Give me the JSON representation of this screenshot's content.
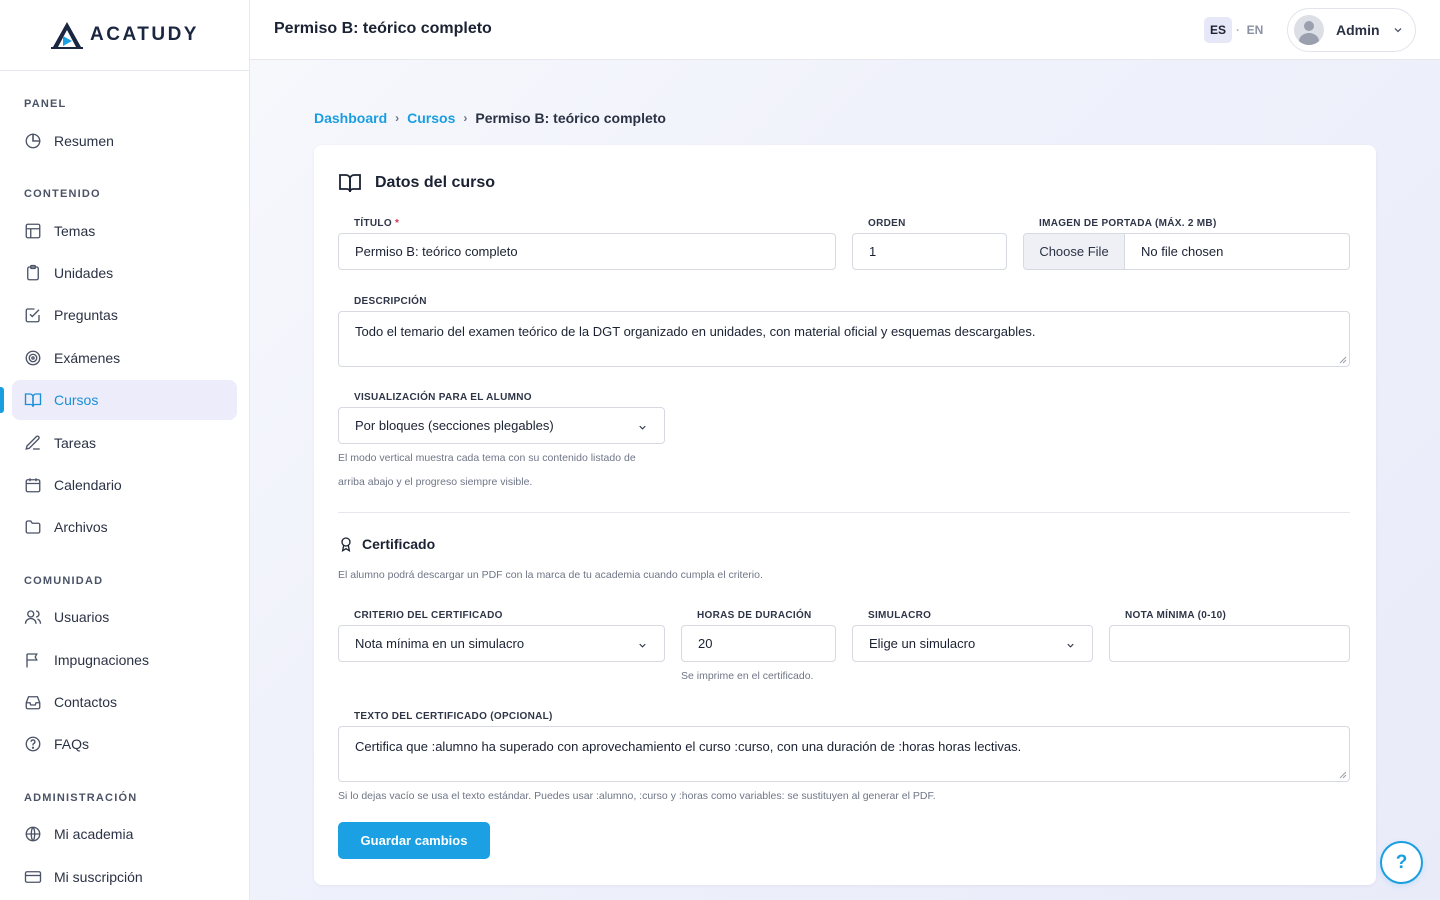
{
  "app": {
    "brand": "ACATUDY"
  },
  "topbar": {
    "title": "Permiso B: teórico completo",
    "lang_es": "ES",
    "lang_sep": "·",
    "lang_en": "EN",
    "user": "Admin"
  },
  "sidebar": {
    "sections": {
      "panel": "PANEL",
      "contenido": "CONTENIDO",
      "comunidad": "COMUNIDAD",
      "administracion": "ADMINISTRACIÓN"
    },
    "items": {
      "resumen": "Resumen",
      "temas": "Temas",
      "unidades": "Unidades",
      "preguntas": "Preguntas",
      "examenes": "Exámenes",
      "cursos": "Cursos",
      "tareas": "Tareas",
      "calendario": "Calendario",
      "archivos": "Archivos",
      "usuarios": "Usuarios",
      "impugnaciones": "Impugnaciones",
      "contactos": "Contactos",
      "faqs": "FAQs",
      "mi_academia": "Mi academia",
      "mi_suscripcion": "Mi suscripción"
    },
    "active": "cursos"
  },
  "breadcrumb": {
    "dashboard": "Dashboard",
    "cursos": "Cursos",
    "current": "Permiso B: teórico completo",
    "separator": "›"
  },
  "form": {
    "card_title": "Datos del curso",
    "titulo": {
      "label": "TÍTULO",
      "required_mark": "*",
      "value": "Permiso B: teórico completo"
    },
    "orden": {
      "label": "ORDEN",
      "value": "1"
    },
    "imagen": {
      "label": "IMAGEN DE PORTADA (MÁX. 2 MB)",
      "button": "Choose File",
      "status": "No file chosen"
    },
    "descripcion": {
      "label": "DESCRIPCIÓN",
      "value": "Todo el temario del examen teórico de la DGT organizado en unidades, con material oficial y esquemas descargables."
    },
    "visualizacion": {
      "label": "VISUALIZACIÓN PARA EL ALUMNO",
      "value": "Por bloques (secciones plegables)",
      "help_line1": "El modo vertical muestra cada tema con su contenido listado de",
      "help_line2": "arriba abajo y el progreso siempre visible."
    },
    "certificado": {
      "title": "Certificado",
      "description": "El alumno podrá descargar un PDF con la marca de tu academia cuando cumpla el criterio.",
      "criterio": {
        "label": "CRITERIO DEL CERTIFICADO",
        "value": "Nota mínima en un simulacro"
      },
      "horas": {
        "label": "HORAS DE DURACIÓN",
        "value": "20",
        "help": "Se imprime en el certificado."
      },
      "simulacro": {
        "label": "SIMULACRO",
        "value": "Elige un simulacro"
      },
      "nota": {
        "label": "NOTA MÍNIMA (0-10)",
        "value": ""
      },
      "texto": {
        "label": "TEXTO DEL CERTIFICADO (OPCIONAL)",
        "value": "Certifica que :alumno ha superado con aprovechamiento el curso :curso, con una duración de :horas horas lectivas.",
        "help": "Si lo dejas vacío se usa el texto estándar. Puedes usar :alumno, :curso y :horas como variables: se sustituyen al generar el PDF."
      }
    },
    "save_button": "Guardar cambios"
  },
  "help_fab": "?",
  "colors": {
    "accent": "#1aa0e3",
    "active_bg": "#ececfa",
    "brand_dark": "#1b2740",
    "required": "#d6334a"
  }
}
